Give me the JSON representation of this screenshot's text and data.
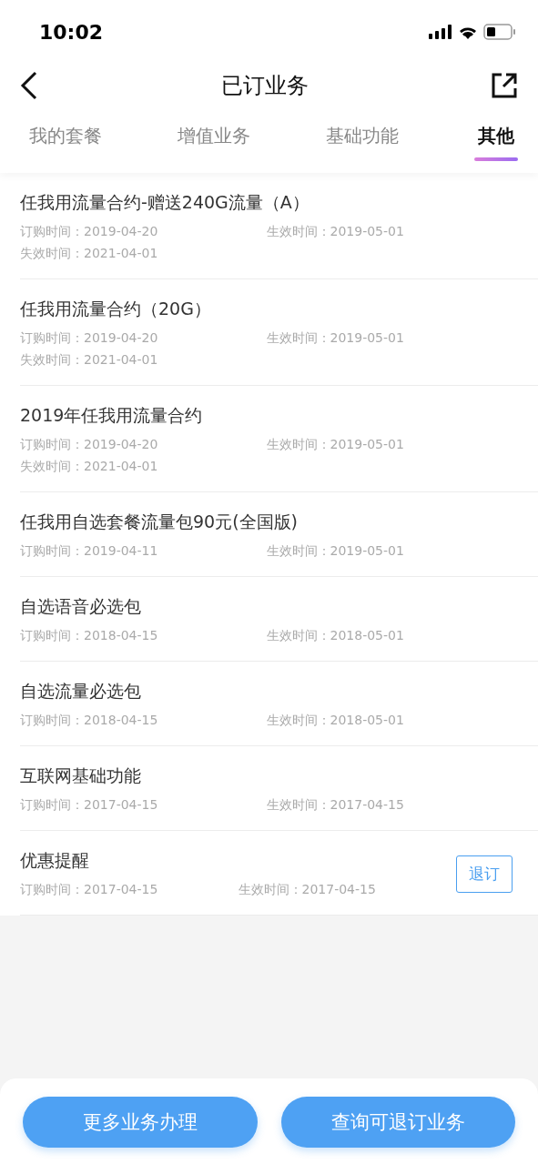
{
  "status_bar": {
    "time": "10:02"
  },
  "nav": {
    "title": "已订业务"
  },
  "tabs": [
    {
      "label": "我的套餐",
      "selected": false
    },
    {
      "label": "增值业务",
      "selected": false
    },
    {
      "label": "基础功能",
      "selected": false
    },
    {
      "label": "其他",
      "selected": true
    }
  ],
  "items": [
    {
      "name": "任我用流量合约-赠送240G流量（A）",
      "ordered": "订购时间：2019-04-20",
      "effective": "生效时间：2019-05-01",
      "expires": "失效时间：2021-04-01"
    },
    {
      "name": "任我用流量合约（20G）",
      "ordered": "订购时间：2019-04-20",
      "effective": "生效时间：2019-05-01",
      "expires": "失效时间：2021-04-01"
    },
    {
      "name": "2019年任我用流量合约",
      "ordered": "订购时间：2019-04-20",
      "effective": "生效时间：2019-05-01",
      "expires": "失效时间：2021-04-01"
    },
    {
      "name": "任我用自选套餐流量包90元(全国版)",
      "ordered": "订购时间：2019-04-11",
      "effective": "生效时间：2019-05-01"
    },
    {
      "name": "自选语音必选包",
      "ordered": "订购时间：2018-04-15",
      "effective": "生效时间：2018-05-01"
    },
    {
      "name": "自选流量必选包",
      "ordered": "订购时间：2018-04-15",
      "effective": "生效时间：2018-05-01"
    },
    {
      "name": "互联网基础功能",
      "ordered": "订购时间：2017-04-15",
      "effective": "生效时间：2017-04-15"
    },
    {
      "name": "优惠提醒",
      "ordered": "订购时间：2017-04-15",
      "effective": "生效时间：2017-04-15",
      "action": "退订"
    }
  ],
  "bottom_buttons": [
    "更多业务办理",
    "查询可退订业务"
  ]
}
